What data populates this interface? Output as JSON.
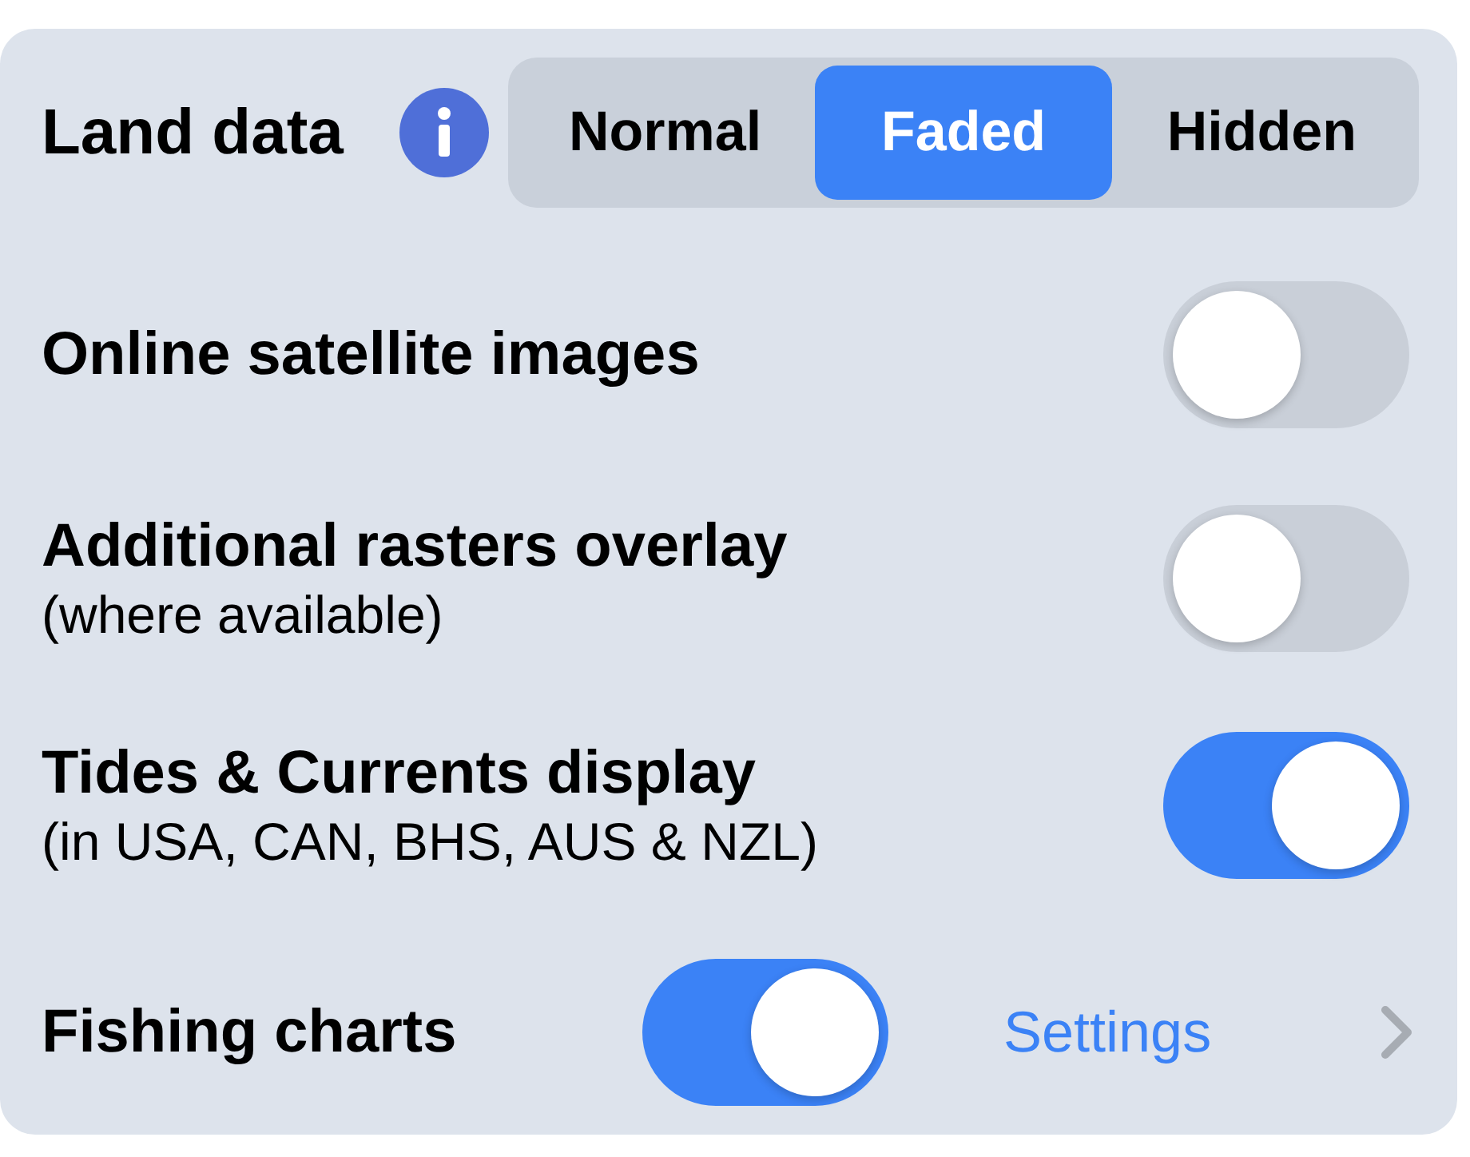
{
  "land_data": {
    "label": "Land data",
    "options": [
      {
        "label": "Normal",
        "selected": false
      },
      {
        "label": "Faded",
        "selected": true
      },
      {
        "label": "Hidden",
        "selected": false
      }
    ]
  },
  "toggles": [
    {
      "title": "Online satellite images",
      "on": false
    },
    {
      "title": "Additional rasters overlay",
      "subtitle": "(where available)",
      "on": false
    },
    {
      "title": "Tides & Currents display",
      "subtitle": "(in USA, CAN, BHS, AUS & NZL)",
      "on": true
    }
  ],
  "fishing": {
    "title": "Fishing charts",
    "on": true,
    "link": "Settings"
  }
}
